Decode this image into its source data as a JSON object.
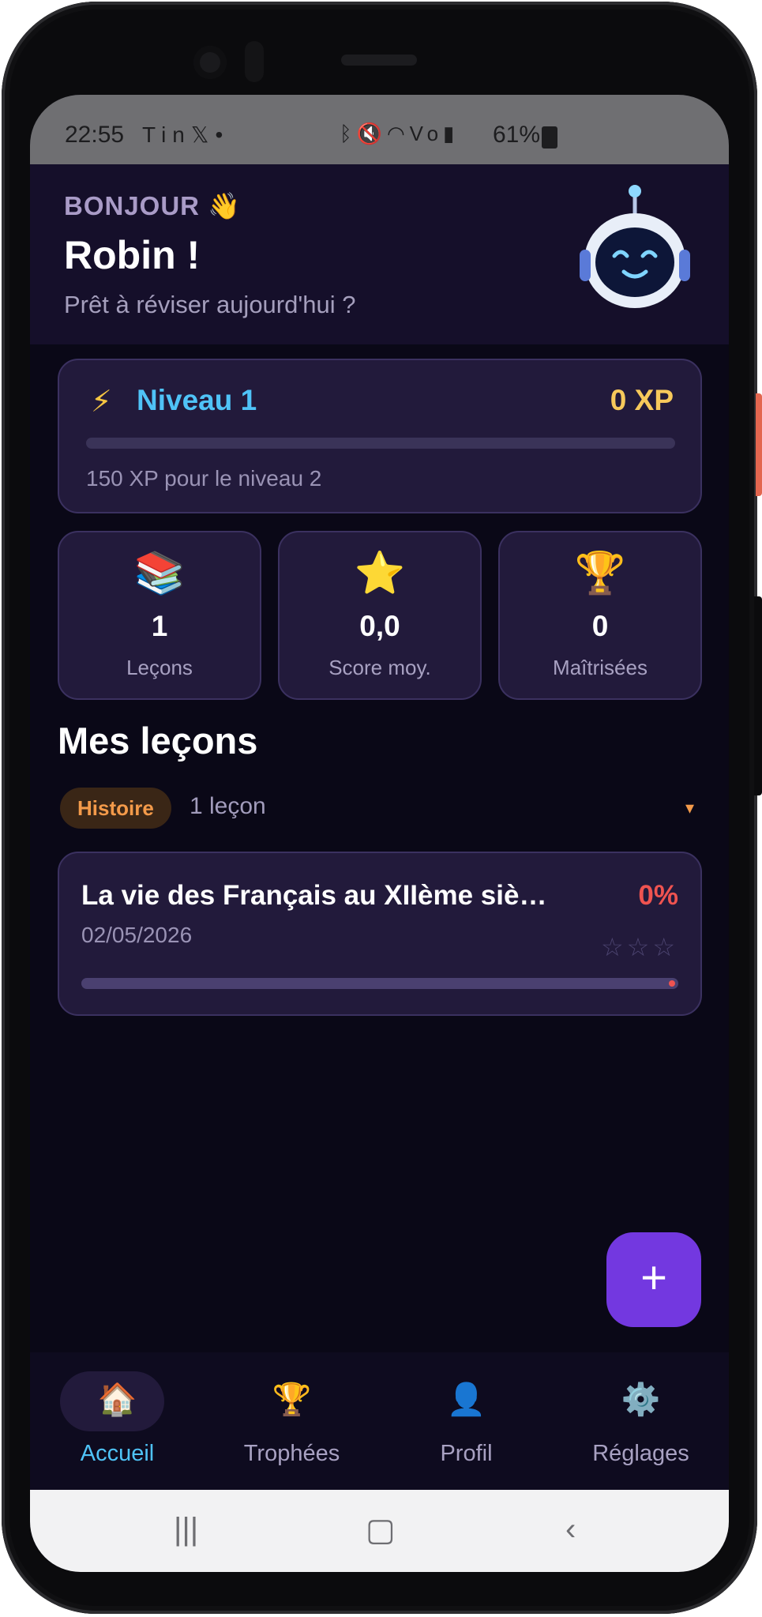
{
  "status_bar": {
    "time": "22:55",
    "left_icons": [
      "tesla-icon",
      "linkedin-icon",
      "x-icon",
      "dot-icon"
    ],
    "right_icons": [
      "bluetooth-icon",
      "mute-icon",
      "wifi-icon",
      "volte-icon",
      "signal-icon"
    ],
    "battery": "61%"
  },
  "header": {
    "greeting": "BONJOUR 👋",
    "name": "Robin !",
    "subtitle": "Prêt à réviser aujourd'hui ?"
  },
  "level": {
    "label": "Niveau 1",
    "xp": "0 XP",
    "progress": 0,
    "next": "150 XP pour le niveau 2"
  },
  "stats": [
    {
      "icon": "📚",
      "value": "1",
      "label": "Leçons"
    },
    {
      "icon": "⭐",
      "value": "0,0",
      "label": "Score moy."
    },
    {
      "icon": "🏆",
      "value": "0",
      "label": "Maîtrisées"
    }
  ],
  "lessons_section": {
    "title": "Mes leçons",
    "category": "Histoire",
    "count": "1 leçon",
    "chevron": "▾"
  },
  "lesson": {
    "title": "La vie des Français au XIIème siè…",
    "percent": "0%",
    "date": "02/05/2026",
    "stars": "☆☆☆",
    "progress": 0
  },
  "fab": {
    "label": "+"
  },
  "bottom_nav": [
    {
      "icon": "🏠",
      "label": "Accueil",
      "active": true
    },
    {
      "icon": "🏆",
      "label": "Trophées",
      "active": false
    },
    {
      "icon": "👤",
      "label": "Profil",
      "active": false
    },
    {
      "icon": "⚙️",
      "label": "Réglages",
      "active": false
    }
  ],
  "colors": {
    "background": "#0a0817",
    "card": "#221a3b",
    "accent": "#4fc3f7",
    "xp": "#f7c95b",
    "fab": "#7338e0",
    "danger": "#ef5350",
    "category": "#f39a4a"
  }
}
